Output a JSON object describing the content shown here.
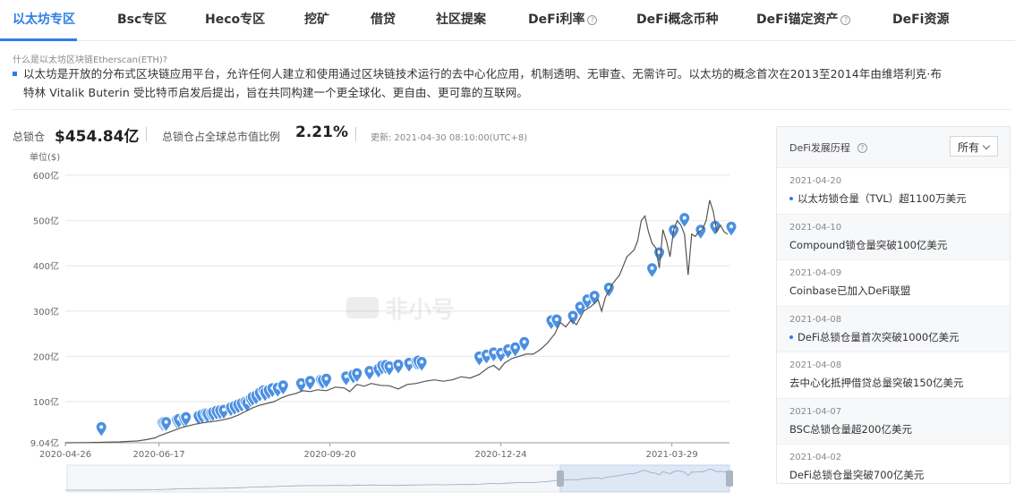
{
  "tabs": [
    {
      "label": "以太坊专区",
      "has_help": false
    },
    {
      "label": "Bsc专区",
      "has_help": false
    },
    {
      "label": "Heco专区",
      "has_help": false
    },
    {
      "label": "挖矿",
      "has_help": false
    },
    {
      "label": "借贷",
      "has_help": false
    },
    {
      "label": "社区提案",
      "has_help": false
    },
    {
      "label": "DeFi利率",
      "has_help": true
    },
    {
      "label": "DeFi概念币种",
      "has_help": false
    },
    {
      "label": "DeFi锚定资产",
      "has_help": true
    },
    {
      "label": "DeFi资源",
      "has_help": false
    }
  ],
  "intro": {
    "question": "什么是以太坊区块链Etherscan(ETH)?",
    "line1": "以太坊是开放的分布式区块链应用平台，允许任何人建立和使用通过区块链技术运行的去中心化应用，机制透明、无审查、无需许可。以太坊的概念首次在2013至2014年由维塔利克·布",
    "line2": "特林 Vitalik Buterin 受比特币启发后提出，旨在共同构建一个更全球化、更自由、更可靠的互联网。"
  },
  "stats": {
    "tvl_label": "总锁仓",
    "tvl_value": "$454.84亿",
    "ratio_label": "总锁仓占全球总市值比例",
    "ratio_value": "2.21%",
    "updated": "更新: 2021-04-30 08:10:00(UTC+8)"
  },
  "watermark": "非小号",
  "colors": {
    "accent": "#2e7ee6",
    "line": "#555555",
    "marker": "#4a90e2"
  },
  "chart_data": {
    "type": "line",
    "title": "",
    "xlabel": "",
    "ylabel": "单位($)",
    "ytick_labels": [
      "9.04亿",
      "100亿",
      "200亿",
      "300亿",
      "400亿",
      "500亿",
      "600亿"
    ],
    "yticks": [
      9.04,
      100,
      200,
      300,
      400,
      500,
      600
    ],
    "ylim": [
      9.04,
      600
    ],
    "xtick_labels": [
      "2020-04-26",
      "2020-06-17",
      "2020-09-20",
      "2020-12-24",
      "2021-03-29"
    ],
    "xticks": [
      0,
      52,
      147,
      242,
      337
    ],
    "xlim_dates": [
      "2020-04-26",
      "2021-04-30"
    ],
    "x_unit": "days from 2020-04-26",
    "grid": true,
    "series": [
      {
        "name": "总锁仓",
        "points": [
          [
            0,
            9
          ],
          [
            10,
            9.5
          ],
          [
            20,
            10
          ],
          [
            30,
            11
          ],
          [
            40,
            13
          ],
          [
            45,
            16
          ],
          [
            50,
            20
          ],
          [
            52,
            24
          ],
          [
            56,
            30
          ],
          [
            60,
            36
          ],
          [
            64,
            42
          ],
          [
            68,
            46
          ],
          [
            72,
            50
          ],
          [
            76,
            53
          ],
          [
            80,
            55
          ],
          [
            84,
            57
          ],
          [
            88,
            60
          ],
          [
            92,
            64
          ],
          [
            96,
            70
          ],
          [
            100,
            78
          ],
          [
            104,
            86
          ],
          [
            108,
            92
          ],
          [
            112,
            96
          ],
          [
            116,
            100
          ],
          [
            120,
            108
          ],
          [
            124,
            114
          ],
          [
            128,
            118
          ],
          [
            132,
            124
          ],
          [
            136,
            122
          ],
          [
            140,
            126
          ],
          [
            145,
            124
          ],
          [
            150,
            132
          ],
          [
            155,
            130
          ],
          [
            158,
            122
          ],
          [
            162,
            138
          ],
          [
            166,
            134
          ],
          [
            170,
            140
          ],
          [
            175,
            136
          ],
          [
            180,
            135
          ],
          [
            185,
            128
          ],
          [
            190,
            138
          ],
          [
            195,
            140
          ],
          [
            200,
            145
          ],
          [
            205,
            148
          ],
          [
            210,
            145
          ],
          [
            215,
            148
          ],
          [
            220,
            155
          ],
          [
            225,
            152
          ],
          [
            230,
            160
          ],
          [
            235,
            175
          ],
          [
            238,
            180
          ],
          [
            241,
            170
          ],
          [
            244,
            185
          ],
          [
            248,
            195
          ],
          [
            252,
            200
          ],
          [
            256,
            205
          ],
          [
            260,
            205
          ],
          [
            264,
            215
          ],
          [
            268,
            230
          ],
          [
            272,
            250
          ],
          [
            275,
            275
          ],
          [
            278,
            265
          ],
          [
            281,
            280
          ],
          [
            284,
            270
          ],
          [
            288,
            300
          ],
          [
            292,
            310
          ],
          [
            296,
            325
          ],
          [
            298,
            300
          ],
          [
            300,
            330
          ],
          [
            304,
            360
          ],
          [
            308,
            380
          ],
          [
            312,
            420
          ],
          [
            316,
            435
          ],
          [
            318,
            455
          ],
          [
            320,
            500
          ],
          [
            322,
            510
          ],
          [
            324,
            475
          ],
          [
            326,
            450
          ],
          [
            328,
            440
          ],
          [
            330,
            395
          ],
          [
            332,
            480
          ],
          [
            334,
            455
          ],
          [
            336,
            420
          ],
          [
            338,
            480
          ],
          [
            340,
            500
          ],
          [
            342,
            490
          ],
          [
            344,
            470
          ],
          [
            346,
            380
          ],
          [
            348,
            470
          ],
          [
            350,
            465
          ],
          [
            352,
            475
          ],
          [
            354,
            480
          ],
          [
            356,
            500
          ],
          [
            358,
            545
          ],
          [
            360,
            520
          ],
          [
            362,
            475
          ],
          [
            364,
            490
          ],
          [
            366,
            475
          ],
          [
            368,
            470
          ]
        ]
      }
    ],
    "event_markers_x": [
      20,
      54,
      55,
      56,
      62,
      63,
      66,
      67,
      74,
      76,
      78,
      79,
      81,
      82,
      84,
      86,
      88,
      92,
      94,
      96,
      98,
      100,
      101,
      103,
      104,
      106,
      108,
      110,
      111,
      113,
      115,
      118,
      121,
      131,
      136,
      142,
      143,
      145,
      156,
      160,
      162,
      169,
      174,
      176,
      178,
      180,
      185,
      191,
      195,
      196,
      198,
      230,
      234,
      238,
      242,
      246,
      250,
      255,
      270,
      273,
      282,
      286,
      290,
      294,
      302,
      326,
      330,
      338,
      344,
      353,
      361,
      370
    ],
    "event_markers_value": [
      36,
      47,
      48,
      47,
      53,
      54,
      56,
      58,
      61,
      64,
      67,
      66,
      68,
      69,
      72,
      73,
      74,
      80,
      83,
      86,
      89,
      92,
      90,
      100,
      103,
      106,
      112,
      117,
      113,
      118,
      122,
      123,
      128,
      133,
      138,
      141,
      140,
      143,
      148,
      152,
      155,
      160,
      165,
      172,
      173,
      170,
      174,
      178,
      182,
      183,
      180,
      192,
      196,
      201,
      200,
      208,
      212,
      224,
      272,
      274,
      282,
      302,
      318,
      326,
      344,
      387,
      422,
      472,
      498,
      472,
      481,
      479
    ]
  },
  "range_slider": {
    "labels": [
      "||",
      "||"
    ],
    "selection": [
      0.65,
      1.0
    ]
  },
  "events": {
    "title": "DeFi发展历程",
    "filter": "所有",
    "items": [
      {
        "date": "2021-04-20",
        "text": "以太坊锁仓量（TVL）超1100万美元",
        "dot": true
      },
      {
        "date": "2021-04-10",
        "text": "Compound锁仓量突破100亿美元",
        "dot": false
      },
      {
        "date": "2021-04-09",
        "text": "Coinbase已加入DeFi联盟",
        "dot": false
      },
      {
        "date": "2021-04-08",
        "text": "DeFi总锁仓量首次突破1000亿美元",
        "dot": true
      },
      {
        "date": "2021-04-08",
        "text": "去中心化抵押借贷总量突破150亿美元",
        "dot": false
      },
      {
        "date": "2021-04-07",
        "text": "BSC总锁仓量超200亿美元",
        "dot": false
      },
      {
        "date": "2021-04-02",
        "text": "DeFi总锁仓量突破700亿美元",
        "dot": false
      }
    ]
  }
}
